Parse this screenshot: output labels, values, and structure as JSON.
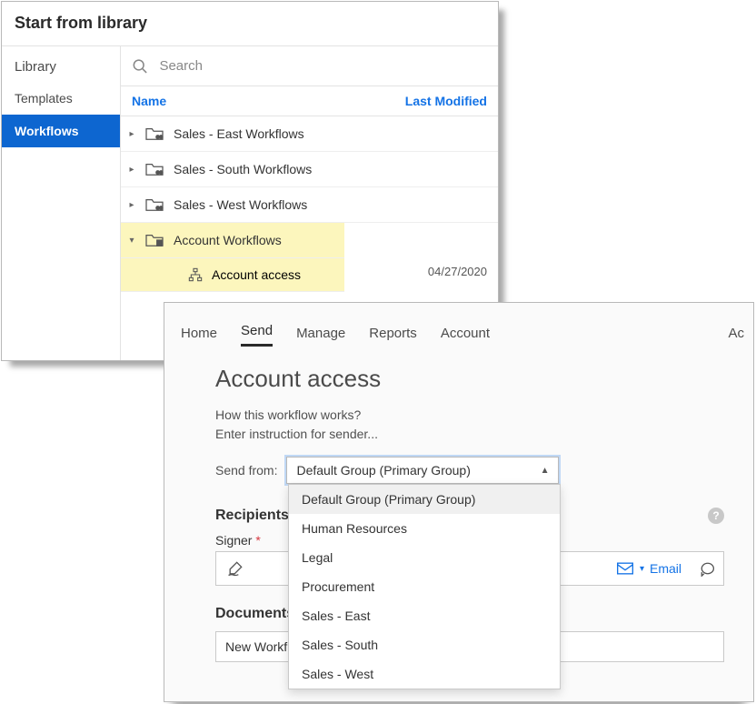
{
  "library": {
    "title": "Start from library",
    "search_placeholder": "Search",
    "sidebar": {
      "heading": "Library",
      "items": [
        "Templates",
        "Workflows"
      ],
      "active_index": 1
    },
    "columns": {
      "name": "Name",
      "modified": "Last Modified"
    },
    "folders": [
      {
        "label": "Sales - East Workflows",
        "expanded": false
      },
      {
        "label": "Sales - South Workflows",
        "expanded": false
      },
      {
        "label": "Sales - West Workflows",
        "expanded": false
      },
      {
        "label": "Account Workflows",
        "expanded": true,
        "selected": true,
        "children": [
          {
            "label": "Account access",
            "date": "04/27/2020"
          }
        ]
      }
    ]
  },
  "send": {
    "nav": {
      "items": [
        "Home",
        "Send",
        "Manage",
        "Reports",
        "Account"
      ],
      "active_index": 1,
      "right_trunc": "Ac"
    },
    "title": "Account access",
    "subtitle_line1": "How this workflow works?",
    "subtitle_line2": "Enter instruction for sender...",
    "sendfrom_label": "Send from:",
    "sendfrom_value": "Default Group (Primary Group)",
    "sendfrom_options": [
      "Default Group (Primary Group)",
      "Human Resources",
      "Legal",
      "Procurement",
      "Sales - East",
      "Sales - South",
      "Sales - West"
    ],
    "recipients_heading": "Recipients",
    "signer_label": "Signer",
    "required_marker": "*",
    "email_label": "Email",
    "documents_heading": "Documents",
    "document_value": "New Workflow"
  }
}
